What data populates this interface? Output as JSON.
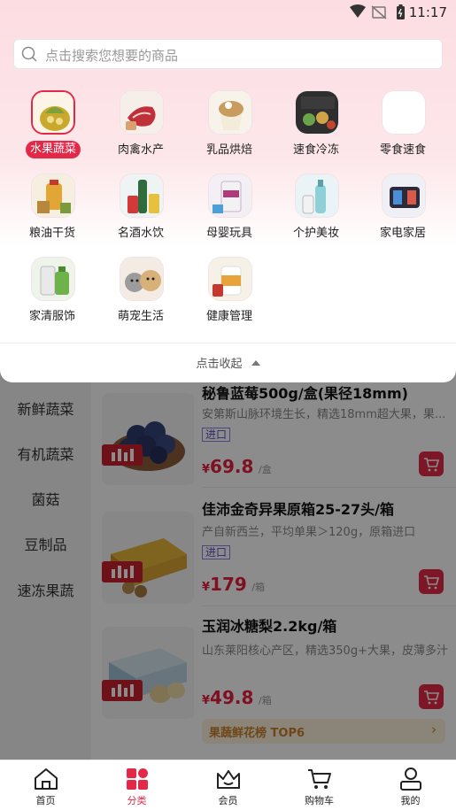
{
  "status_bar": {
    "time": "11:17"
  },
  "search": {
    "placeholder": "点击搜索您想要的商品"
  },
  "categories": [
    {
      "label": "水果蔬菜",
      "active": true
    },
    {
      "label": "肉禽水产"
    },
    {
      "label": "乳品烘焙"
    },
    {
      "label": "速食冷冻"
    },
    {
      "label": "零食速食"
    },
    {
      "label": "粮油干货"
    },
    {
      "label": "名酒水饮"
    },
    {
      "label": "母婴玩具"
    },
    {
      "label": "个护美妆"
    },
    {
      "label": "家电家居"
    },
    {
      "label": "家清服饰"
    },
    {
      "label": "萌宠生活"
    },
    {
      "label": "健康管理"
    }
  ],
  "collapse_label": "点击收起",
  "left_categories": [
    "新鲜蔬菜",
    "有机蔬菜",
    "菌菇",
    "豆制品",
    "速冻果蔬"
  ],
  "products": [
    {
      "title": "秘鲁蓝莓500g/盒(果径18mm)",
      "desc": "安第斯山脉环境生长，精选18mm超大果，果...",
      "tag": "进口",
      "price_symbol": "¥",
      "price": "69.8",
      "unit": "/盒"
    },
    {
      "title": "佳沛金奇异果原箱25-27头/箱",
      "desc": "产自新西兰，平均单果＞120g，原箱进口",
      "tag": "进口",
      "price_symbol": "¥",
      "price": "179",
      "unit": "/箱"
    },
    {
      "title": "玉润冰糖梨2.2kg/箱",
      "desc": "山东莱阳核心产区，精选350g+大果，皮薄多汁",
      "tag": "",
      "price_symbol": "¥",
      "price": "49.8",
      "unit": "/箱"
    }
  ],
  "rank_bar": {
    "label": "果蔬鲜花榜 TOP6"
  },
  "bottom_nav": [
    {
      "label": "首页"
    },
    {
      "label": "分类",
      "active": true
    },
    {
      "label": "会员"
    },
    {
      "label": "购物车"
    },
    {
      "label": "我的"
    }
  ],
  "colors": {
    "accent": "#e42848",
    "panel_top": "#fcdde2",
    "price": "#e6203c",
    "import_tag": "#5b4cc4"
  }
}
